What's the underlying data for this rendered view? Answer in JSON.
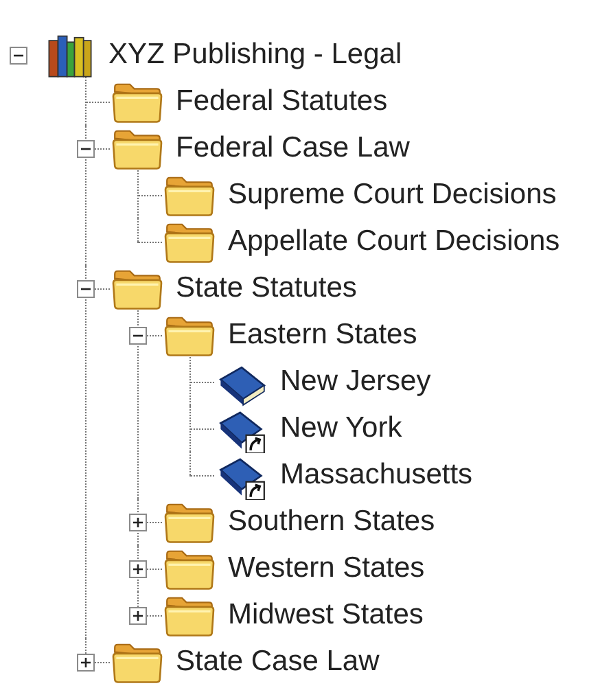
{
  "tree": [
    {
      "label": "XYZ Publishing - Legal",
      "kind": "library",
      "expanded": true,
      "children": [
        {
          "label": "Federal Statutes",
          "kind": "folder"
        },
        {
          "label": "Federal Case Law",
          "kind": "folder",
          "expanded": true,
          "children": [
            {
              "label": "Supreme Court Decisions",
              "kind": "folder"
            },
            {
              "label": "Appellate Court Decisions",
              "kind": "folder"
            }
          ]
        },
        {
          "label": "State Statutes",
          "kind": "folder",
          "expanded": true,
          "children": [
            {
              "label": "Eastern States",
              "kind": "folder",
              "expanded": true,
              "children": [
                {
                  "label": "New Jersey",
                  "kind": "book"
                },
                {
                  "label": "New York",
                  "kind": "shortcut"
                },
                {
                  "label": "Massachusetts",
                  "kind": "shortcut"
                }
              ]
            },
            {
              "label": "Southern States",
              "kind": "folder",
              "expanded": false
            },
            {
              "label": "Western States",
              "kind": "folder",
              "expanded": false
            },
            {
              "label": "Midwest States",
              "kind": "folder",
              "expanded": false
            }
          ]
        },
        {
          "label": "State Case Law",
          "kind": "folder",
          "expanded": false
        }
      ]
    }
  ]
}
